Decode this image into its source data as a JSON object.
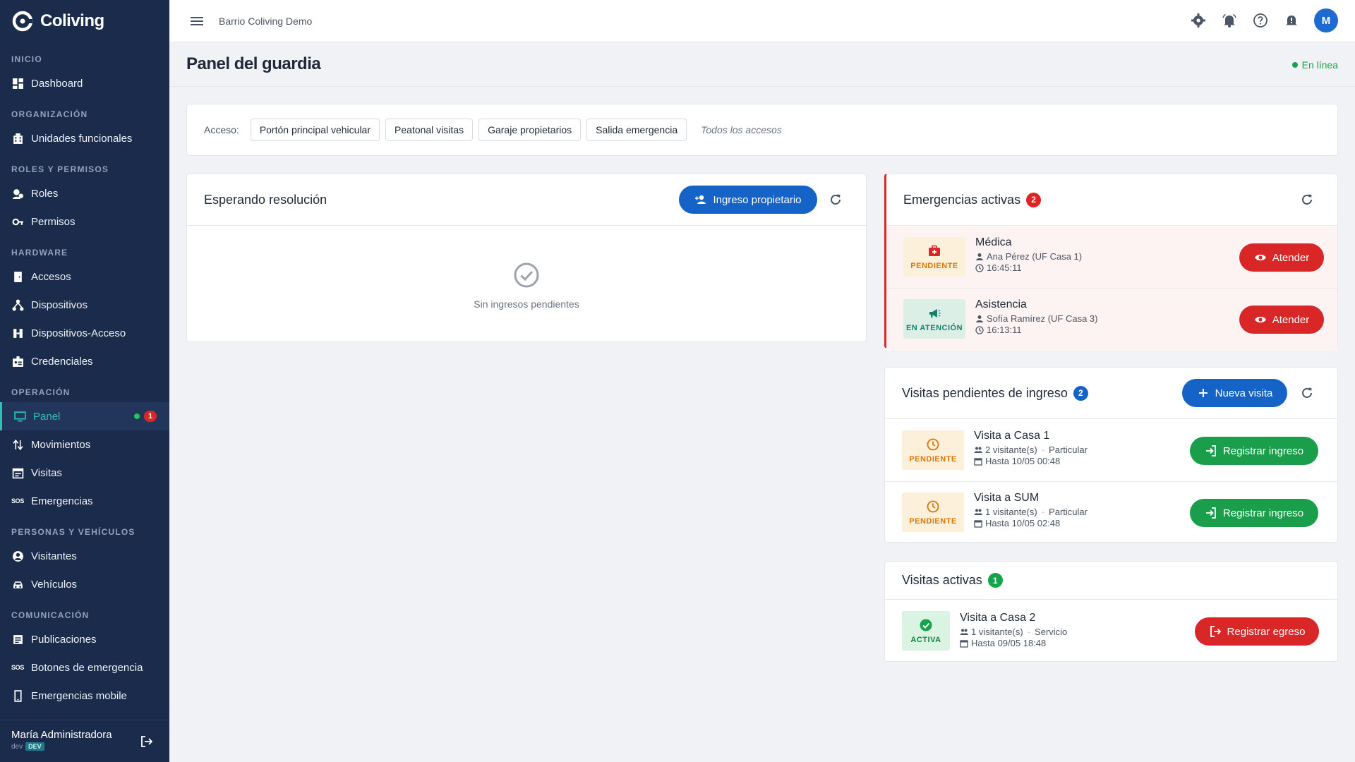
{
  "brand": {
    "name": "Coliving"
  },
  "sidebar": {
    "sections": [
      {
        "title": "INICIO",
        "items": [
          {
            "label": "Dashboard",
            "icon": "dashboard-icon"
          }
        ]
      },
      {
        "title": "ORGANIZACIÓN",
        "items": [
          {
            "label": "Unidades funcionales",
            "icon": "building-icon"
          }
        ]
      },
      {
        "title": "ROLES Y PERMISOS",
        "items": [
          {
            "label": "Roles",
            "icon": "roles-icon"
          },
          {
            "label": "Permisos",
            "icon": "key-icon"
          }
        ]
      },
      {
        "title": "HARDWARE",
        "items": [
          {
            "label": "Accesos",
            "icon": "door-icon"
          },
          {
            "label": "Dispositivos",
            "icon": "devices-icon"
          },
          {
            "label": "Dispositivos-Acceso",
            "icon": "device-access-icon"
          },
          {
            "label": "Credenciales",
            "icon": "badge-icon"
          }
        ]
      },
      {
        "title": "OPERACIÓN",
        "items": [
          {
            "label": "Panel",
            "icon": "monitor-icon"
          },
          {
            "label": "Movimientos",
            "icon": "swap-icon"
          },
          {
            "label": "Visitas",
            "icon": "calendar-icon"
          },
          {
            "label": "Emergencias",
            "icon": "sos-icon"
          }
        ]
      },
      {
        "title": "PERSONAS Y VEHÍCULOS",
        "items": [
          {
            "label": "Visitantes",
            "icon": "person-icon"
          },
          {
            "label": "Vehículos",
            "icon": "car-icon"
          }
        ]
      },
      {
        "title": "COMUNICACIÓN",
        "items": [
          {
            "label": "Publicaciones",
            "icon": "article-icon"
          },
          {
            "label": "Botones de emergencia",
            "icon": "sos-icon"
          },
          {
            "label": "Emergencias mobile",
            "icon": "phone-icon"
          }
        ]
      }
    ],
    "panel_badge": "1",
    "user": {
      "name": "María Administradora",
      "role": "dev",
      "env": "DEV"
    }
  },
  "topbar": {
    "title": "Barrio Coliving Demo",
    "avatar_initial": "M"
  },
  "page": {
    "title": "Panel del guardia",
    "status": "En línea"
  },
  "access": {
    "label": "Acceso:",
    "chips": [
      "Portón principal vehicular",
      "Peatonal visitas",
      "Garaje propietarios",
      "Salida emergencia"
    ],
    "all": "Todos los accesos"
  },
  "waiting": {
    "title": "Esperando resolución",
    "button": "Ingreso propietario",
    "empty": "Sin ingresos pendientes"
  },
  "emergencies": {
    "title": "Emergencias activas",
    "count": "2",
    "rows": [
      {
        "status": "PENDIENTE",
        "title": "Médica",
        "person": "Ana Pérez (UF Casa 1)",
        "time": "16:45:11",
        "button": "Atender"
      },
      {
        "status": "EN ATENCIÓN",
        "title": "Asistencia",
        "person": "Sofía Ramírez (UF Casa 3)",
        "time": "16:13:11",
        "button": "Atender"
      }
    ]
  },
  "pending_visits": {
    "title": "Visitas pendientes de ingreso",
    "count": "2",
    "button": "Nueva visita",
    "rows": [
      {
        "status": "PENDIENTE",
        "title": "Visita a Casa 1",
        "visitors": "2 visitante(s)",
        "type": "Particular",
        "until": "Hasta 10/05 00:48",
        "button": "Registrar ingreso"
      },
      {
        "status": "PENDIENTE",
        "title": "Visita a SUM",
        "visitors": "1 visitante(s)",
        "type": "Particular",
        "until": "Hasta 10/05 02:48",
        "button": "Registrar ingreso"
      }
    ]
  },
  "active_visits": {
    "title": "Visitas activas",
    "count": "1",
    "rows": [
      {
        "status": "ACTIVA",
        "title": "Visita a Casa 2",
        "visitors": "1 visitante(s)",
        "type": "Servicio",
        "until": "Hasta 09/05 18:48",
        "button": "Registrar egreso"
      }
    ]
  },
  "colors": {
    "sidebar": "#1a2b4c",
    "accent": "#2bc1b5",
    "blue": "#1663c7",
    "red": "#d92626",
    "green": "#1b9e4b"
  }
}
